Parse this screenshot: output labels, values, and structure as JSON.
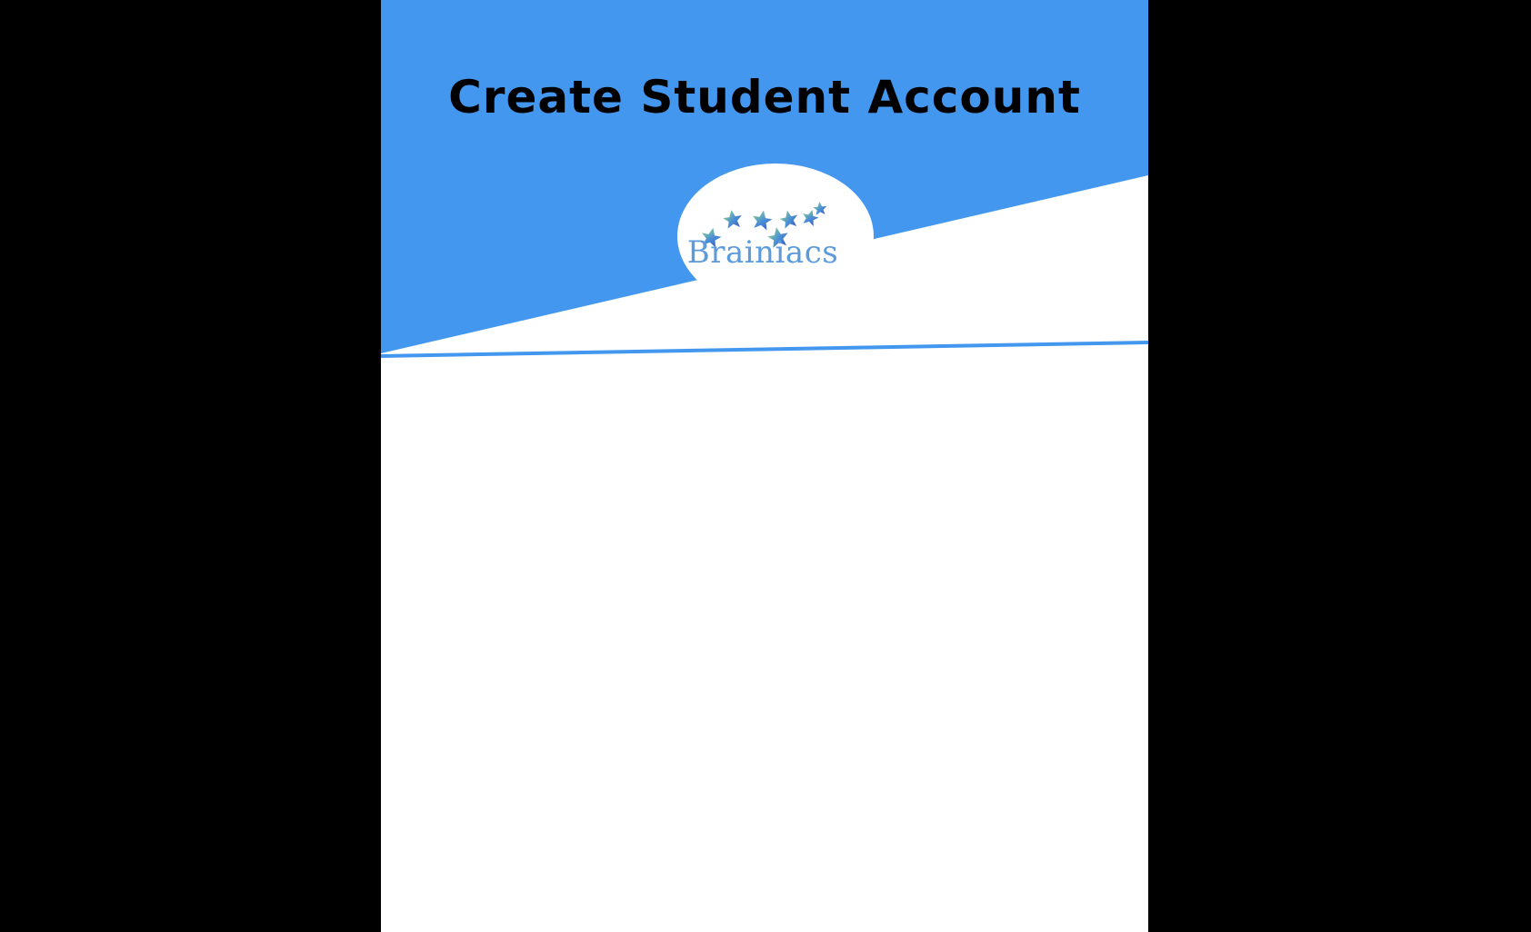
{
  "page": {
    "title": "Create Student Account"
  },
  "logo": {
    "text": "Brainiacs",
    "icon": "stars-icon"
  },
  "colors": {
    "accent": "#4397ef",
    "letterbox": "#000000",
    "background": "#ffffff",
    "logo_text": "#5b9bdc"
  }
}
